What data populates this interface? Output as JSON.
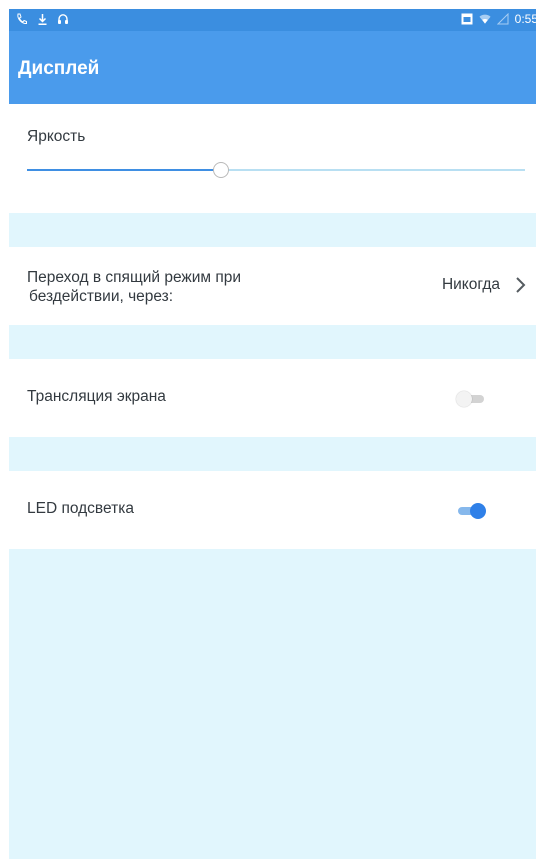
{
  "status_bar": {
    "time": "0:55",
    "left_icons": [
      "call-icon",
      "download-icon",
      "headset-icon"
    ],
    "right_icons": [
      "notification-box-icon",
      "wifi-icon",
      "signal-icon"
    ]
  },
  "header": {
    "title": "Дисплей"
  },
  "settings": {
    "brightness": {
      "label": "Яркость",
      "level_fraction": 0.39
    },
    "sleep": {
      "label_line1": "Переход в спящий режим при",
      "label_line2": "бездействии, через:",
      "value": "Никогда"
    },
    "screen_cast": {
      "label": "Трансляция экрана",
      "enabled": false
    },
    "led": {
      "label": "LED подсветка",
      "enabled": true
    }
  },
  "colors": {
    "header_bg": "#4a9bec",
    "status_bar_bg": "#3b8ee0",
    "page_bg": "#e1f6fd",
    "accent": "#2f80e8"
  }
}
